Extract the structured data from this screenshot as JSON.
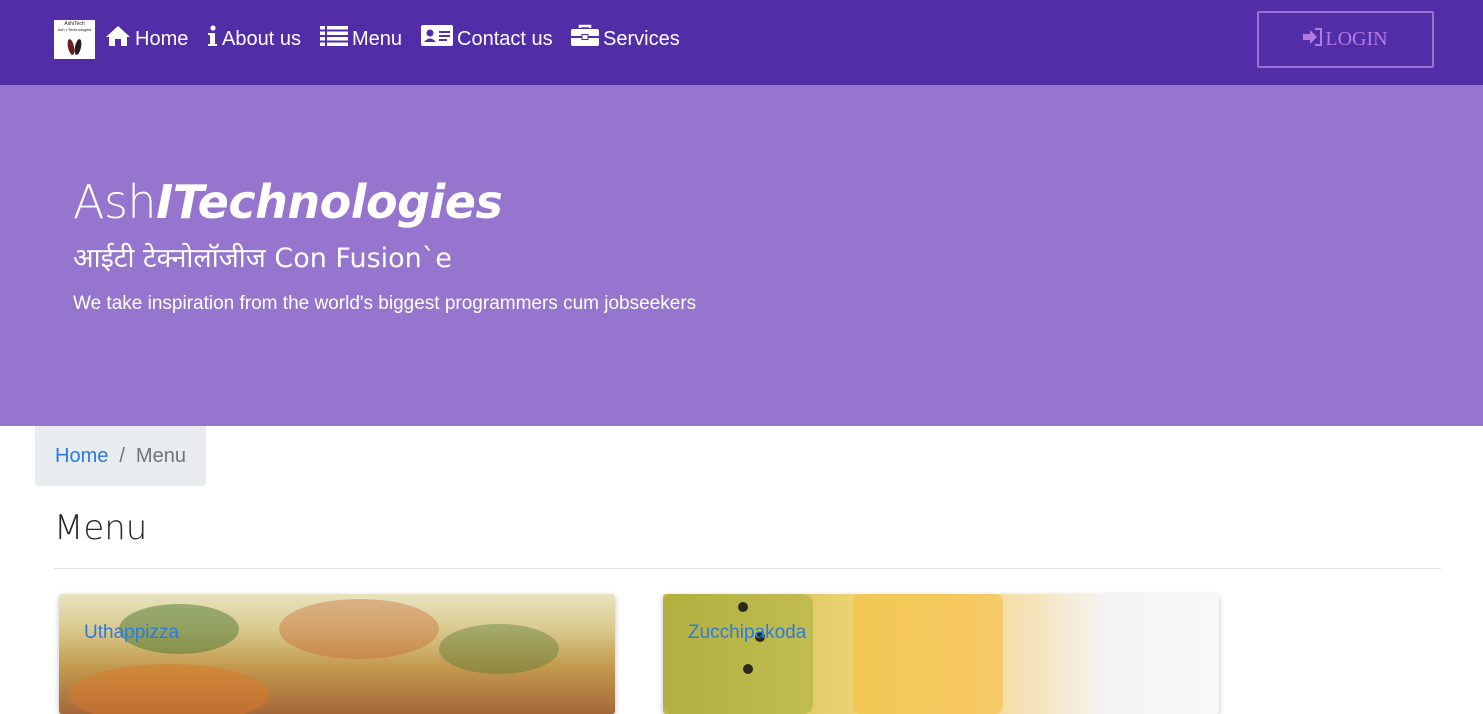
{
  "brand": {
    "logo_line1": "AshiTech",
    "logo_line2": "Ash I Technologies"
  },
  "nav": {
    "home": "Home",
    "about": "About us",
    "menu": "Menu",
    "contact": "Contact us",
    "services": "Services",
    "login": "LOGIN"
  },
  "icons": {
    "home": "home-icon",
    "about": "info-icon",
    "menu": "list-icon",
    "contact": "address-card-icon",
    "services": "briefcase-icon",
    "login": "sign-in-icon"
  },
  "jumbotron": {
    "title_plain": "Ash",
    "title_emph": "ITechnologies",
    "subtitle": "आईटी टेक्नोलॉजीज Con Fusion`e",
    "tagline": "We take inspiration from the world's biggest programmers cum jobseekers"
  },
  "breadcrumb": {
    "home": "Home",
    "separator": "/",
    "current": "Menu"
  },
  "page": {
    "heading": "Menu"
  },
  "cards": [
    {
      "title": "Uthappizza"
    },
    {
      "title": "Zucchipakoda"
    }
  ],
  "colors": {
    "navbar": "#512DA8",
    "jumbotron": "#9575CD",
    "link": "#2a7ae2",
    "login_border": "#9B6FD6"
  }
}
